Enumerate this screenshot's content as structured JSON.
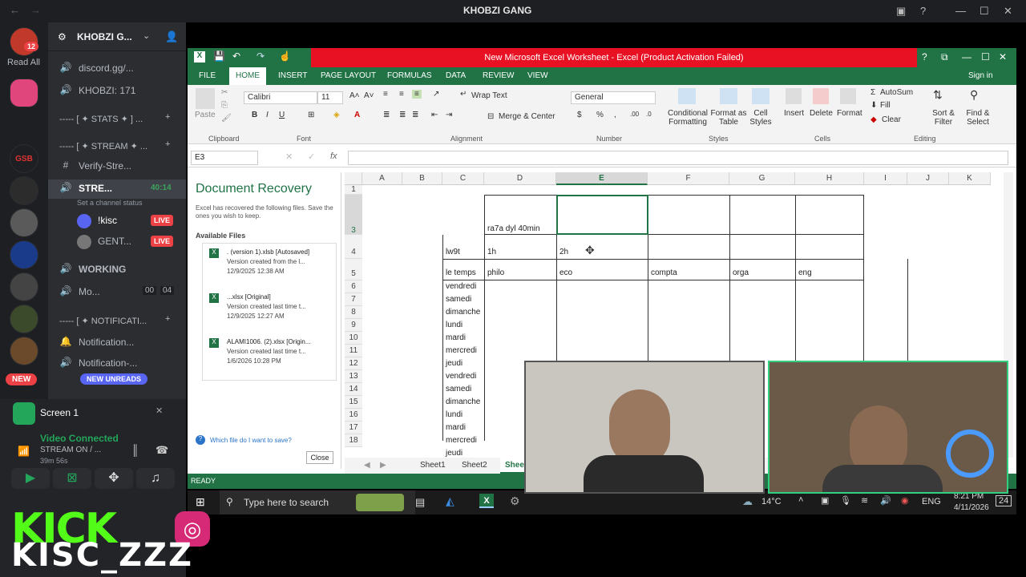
{
  "desktop": {
    "title": "KHOBZI GANG"
  },
  "discord": {
    "server_name": "KHOBZI G...",
    "notif_badge": "12",
    "read_all": "Read All",
    "new_badge": "NEW",
    "new_unreads": "NEW UNREADS",
    "channels": [
      {
        "label": "discord.gg/...",
        "icon": "speaker-icon"
      },
      {
        "label": "KHOBZI: 171",
        "icon": "speaker-icon"
      },
      {
        "label": "----- [ ✦ STATS ✦ ] ...",
        "icon": "none"
      },
      {
        "label": "----- [ ✦ STREAM ✦ ...",
        "icon": "none"
      },
      {
        "label": "Verify-Stre...",
        "icon": "hash-icon"
      },
      {
        "label": "STRE...",
        "icon": "speaker-icon"
      },
      {
        "label": "WORKING",
        "icon": "speaker-icon"
      },
      {
        "label": "Mo...",
        "icon": "speaker-icon"
      },
      {
        "label": "----- [ ✦ NOTIFICATI...",
        "icon": "none"
      },
      {
        "label": "Notification...",
        "icon": "speaker-icon"
      },
      {
        "label": "Notification-...",
        "icon": "speaker-icon"
      }
    ],
    "stream_timer": "40:14",
    "set_status": "Set a channel status",
    "users": [
      {
        "name": "!kisc",
        "badge": "LIVE"
      },
      {
        "name": "GENT...",
        "badge": "LIVE"
      }
    ],
    "mo_counts": [
      "00",
      "04"
    ],
    "screen_label": "Screen 1",
    "video_connected": "Video Connected",
    "stream_on": "STREAM ON / ...",
    "call_time": "39m 56s"
  },
  "excel": {
    "window_title": "New Microsoft Excel Worksheet - Excel (Product Activation Failed)",
    "sign_in": "Sign in",
    "tabs": [
      "FILE",
      "HOME",
      "INSERT",
      "PAGE LAYOUT",
      "FORMULAS",
      "DATA",
      "REVIEW",
      "VIEW"
    ],
    "font_name": "Calibri",
    "font_size": "11",
    "number_format": "General",
    "ribbon": {
      "paste": "Paste",
      "wrap_text": "Wrap Text",
      "merge_center": "Merge & Center",
      "conditional": "Conditional Formatting",
      "format_table": "Format as Table",
      "cell_styles": "Cell Styles",
      "insert": "Insert",
      "delete": "Delete",
      "format": "Format",
      "autosum": "AutoSum",
      "fill": "Fill",
      "clear": "Clear",
      "sort_filter": "Sort & Filter",
      "find_select": "Find & Select",
      "groups": [
        "Clipboard",
        "Font",
        "Alignment",
        "Number",
        "Styles",
        "Cells",
        "Editing"
      ]
    },
    "name_box": "E3",
    "recovery": {
      "title": "Document Recovery",
      "desc": "Excel has recovered the following files. Save the ones you wish to keep.",
      "available": "Available Files",
      "files": [
        {
          "name": ". (version 1).xlsb  [Autosaved]",
          "line2": "Version created from the l...",
          "date": "12/9/2025 12:38 AM"
        },
        {
          "name": "...xlsx  [Original]",
          "line2": "Version created last time t...",
          "date": "12/9/2025 12:27 AM"
        },
        {
          "name": "ALAMI1006. (2).xlsx  [Origin...",
          "line2": "Version created last time t...",
          "date": "1/6/2026 10:28 PM"
        }
      ],
      "which_file": "Which file do I want to save?",
      "close": "Close"
    },
    "columns": [
      "A",
      "B",
      "C",
      "D",
      "E",
      "F",
      "G",
      "H",
      "I",
      "J",
      "K"
    ],
    "rows": [
      "1",
      "3",
      "4",
      "5",
      "6",
      "7",
      "8",
      "9",
      "10",
      "11",
      "12",
      "13",
      "14",
      "15",
      "16",
      "17",
      "18"
    ],
    "cells": {
      "d3": "ra7a dyl 40min",
      "c4": "lw9t",
      "d4": "1h",
      "e4": "2h",
      "c5": "le temps",
      "d5": "philo",
      "e5": "eco",
      "f5": "compta",
      "g5": "orga",
      "h5": "eng",
      "days": [
        "vendredi",
        "samedi",
        "dimanche",
        "lundi",
        "mardi",
        "mercredi",
        "jeudi",
        "vendredi",
        "samedi",
        "dimanche",
        "lundi",
        "mardi",
        "mercredi",
        "jeudi"
      ]
    },
    "sheets": [
      "Sheet1",
      "Sheet2",
      "Sheet"
    ],
    "status": "READY"
  },
  "taskbar": {
    "search": "Type here to search",
    "temp": "14°C",
    "lang": "ENG",
    "time": "8:21 PM",
    "date": "4/11/2026",
    "notif": "24"
  },
  "overlay": {
    "kick": "KICK",
    "handle": "KISC_ZZZ"
  }
}
